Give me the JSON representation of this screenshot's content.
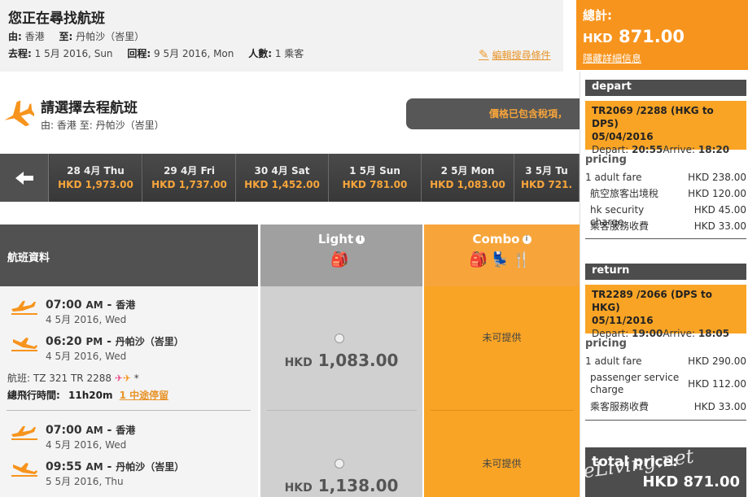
{
  "search": {
    "title": "您正在尋找航班",
    "from_label": "由:",
    "from": "香港",
    "to_label": "至:",
    "to": "丹帕沙（峇里）",
    "depart_label": "去程:",
    "depart_date": "1 5月 2016, Sun",
    "return_label": "回程:",
    "return_date": "9 5月 2016, Mon",
    "pax_label": "人數:",
    "pax": "1 乘客",
    "edit_label": "編輯搜尋條件"
  },
  "total": {
    "label": "總計:",
    "currency": "HKD",
    "amount": "871.00",
    "hide_details": "隱藏詳細信息"
  },
  "summary": {
    "depart": {
      "header": "depart",
      "flight": "TR2069 /2288 (HKG to DPS)",
      "date": "05/04/2016",
      "depart_label": "Depart:",
      "depart_time": "20:55",
      "arrive_label": "Arrive:",
      "arrive_time": "18:20",
      "pricing_label": "pricing",
      "rows": [
        {
          "name": "1 adult fare",
          "value": "HKD 238.00"
        },
        {
          "name": "航空旅客出境稅",
          "value": "HKD 120.00"
        },
        {
          "name": "hk security charge",
          "value": "HKD 45.00"
        },
        {
          "name": "乘客服務收費",
          "value": "HKD 33.00"
        }
      ]
    },
    "return": {
      "header": "return",
      "flight": "TR2289 /2066 (DPS to HKG)",
      "date": "05/11/2016",
      "depart_label": "Depart:",
      "depart_time": "19:00",
      "arrive_label": "Arrive:",
      "arrive_time": "18:05",
      "pricing_label": "pricing",
      "rows": [
        {
          "name": "1 adult fare",
          "value": "HKD 290.00"
        },
        {
          "name": "passenger service charge",
          "value": "HKD 112.00"
        },
        {
          "name": "乘客服務收費",
          "value": "HKD 33.00"
        }
      ]
    },
    "total_price_label": "total price:",
    "total_price": "HKD 871.00",
    "watermark": "eLiving.net"
  },
  "select": {
    "title": "請選擇去程航班",
    "route_from_label": "由:",
    "route_from": "香港",
    "route_to_label": "至:",
    "route_to": "丹帕沙（峇里）",
    "tax_note": "價格已包含稅項，"
  },
  "dates": [
    {
      "date": "28 4月 Thu",
      "price": "HKD 1,973.00"
    },
    {
      "date": "29 4月 Fri",
      "price": "HKD 1,737.00"
    },
    {
      "date": "30 4月 Sat",
      "price": "HKD 1,452.00"
    },
    {
      "date": "1 5月 Sun",
      "price": "HKD 781.00"
    },
    {
      "date": "2 5月 Mon",
      "price": "HKD 1,083.00"
    },
    {
      "date": "3 5月 Tu",
      "price": "HKD 721."
    }
  ],
  "table": {
    "info_header": "航班資料",
    "light_header": "Light",
    "combo_header": "Combo",
    "flights": [
      {
        "dep_time": "07:00",
        "dep_ampm": "AM",
        "dep_city": "香港",
        "dep_date": "4 5月 2016, Wed",
        "arr_time": "06:20",
        "arr_ampm": "PM",
        "arr_city": "丹帕沙（峇里）",
        "arr_date": "4 5月 2016, Wed",
        "flight_label": "航班:",
        "flight_nos": "TZ 321 TR 2288",
        "flight_mark": "*",
        "duration_label": "總飛行時間:",
        "duration": "11h20m",
        "stops": "1 中途停留",
        "light_currency": "HKD",
        "light_price": "1,083.00",
        "combo": "未可提供"
      },
      {
        "dep_time": "07:00",
        "dep_ampm": "AM",
        "dep_city": "香港",
        "dep_date": "4 5月 2016, Wed",
        "arr_time": "09:55",
        "arr_ampm": "AM",
        "arr_city": "丹帕沙（峇里）",
        "arr_date": "5 5月 2016, Thu",
        "light_currency": "HKD",
        "light_price": "1,138.00",
        "combo": "未可提供"
      }
    ]
  },
  "colors": {
    "accent": "#f7941d",
    "dark": "#4d4d4d"
  }
}
